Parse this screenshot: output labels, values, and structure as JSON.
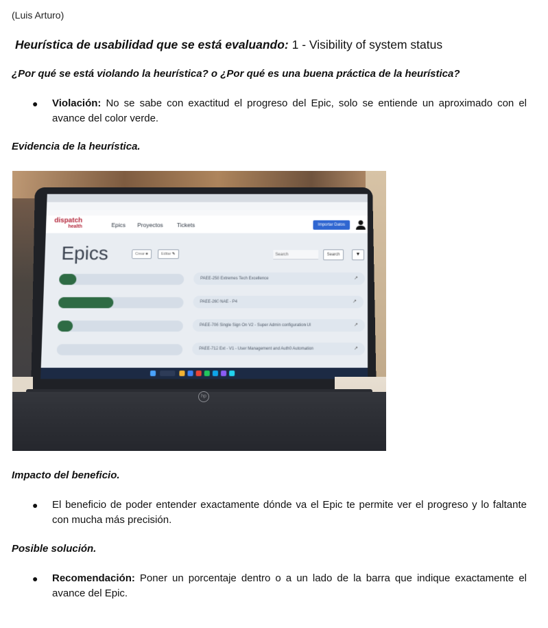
{
  "author": "(Luis Arturo)",
  "heuristic": {
    "label": "Heurística de usabilidad que se está evaluando:",
    "value": " 1 - Visibility of system status"
  },
  "question": "¿Por qué se está violando la heurística? o ¿Por qué es una buena práctica de la heurística?",
  "violation": {
    "label": "Violación:",
    "text": " No se sabe con exactitud el progreso del Epic, solo se entiende un aproximado con el avance del color verde."
  },
  "evidence_title": "Evidencia de la heurística.",
  "photo": {
    "screen": {
      "brand_line1": "dispatch",
      "brand_line2": "health",
      "nav": [
        "Epics",
        "Proyectos",
        "Tickets"
      ],
      "import_button": "Importar Datos",
      "page_title": "Epics",
      "btn_crear": "Crear",
      "btn_editar": "Editar",
      "search_placeholder": "Search",
      "search_button": "Search",
      "filter_icon": "filter-icon",
      "epics": [
        {
          "progress": 0.14,
          "label": "PAEE-258 Extremes Tech Excellence"
        },
        {
          "progress": 0.44,
          "label": "PAEE-260 NAE - P4"
        },
        {
          "progress": 0.12,
          "label": "PAEE-706 Single Sign On V2 - Super Admin configuration UI"
        },
        {
          "progress": 0.0,
          "label": "PAEE-712 Ext - V1 - User Management and Auth0 Automation"
        }
      ],
      "colors": {
        "progress_fill": "#2e6b44",
        "progress_track": "#d5dde7",
        "accent": "#2f66d1",
        "brand": "#b3263a"
      }
    }
  },
  "impact_title": "Impacto del beneficio.",
  "impact_text": "El beneficio de poder entender exactamente dónde va el Epic te permite ver el progreso y lo faltante con mucha más precisión.",
  "solution_title": "Posible solución.",
  "recommendation": {
    "label": "Recomendación:",
    "text": " Poner un porcentaje dentro o a un lado de la barra que indique exactamente el avance del Epic."
  }
}
